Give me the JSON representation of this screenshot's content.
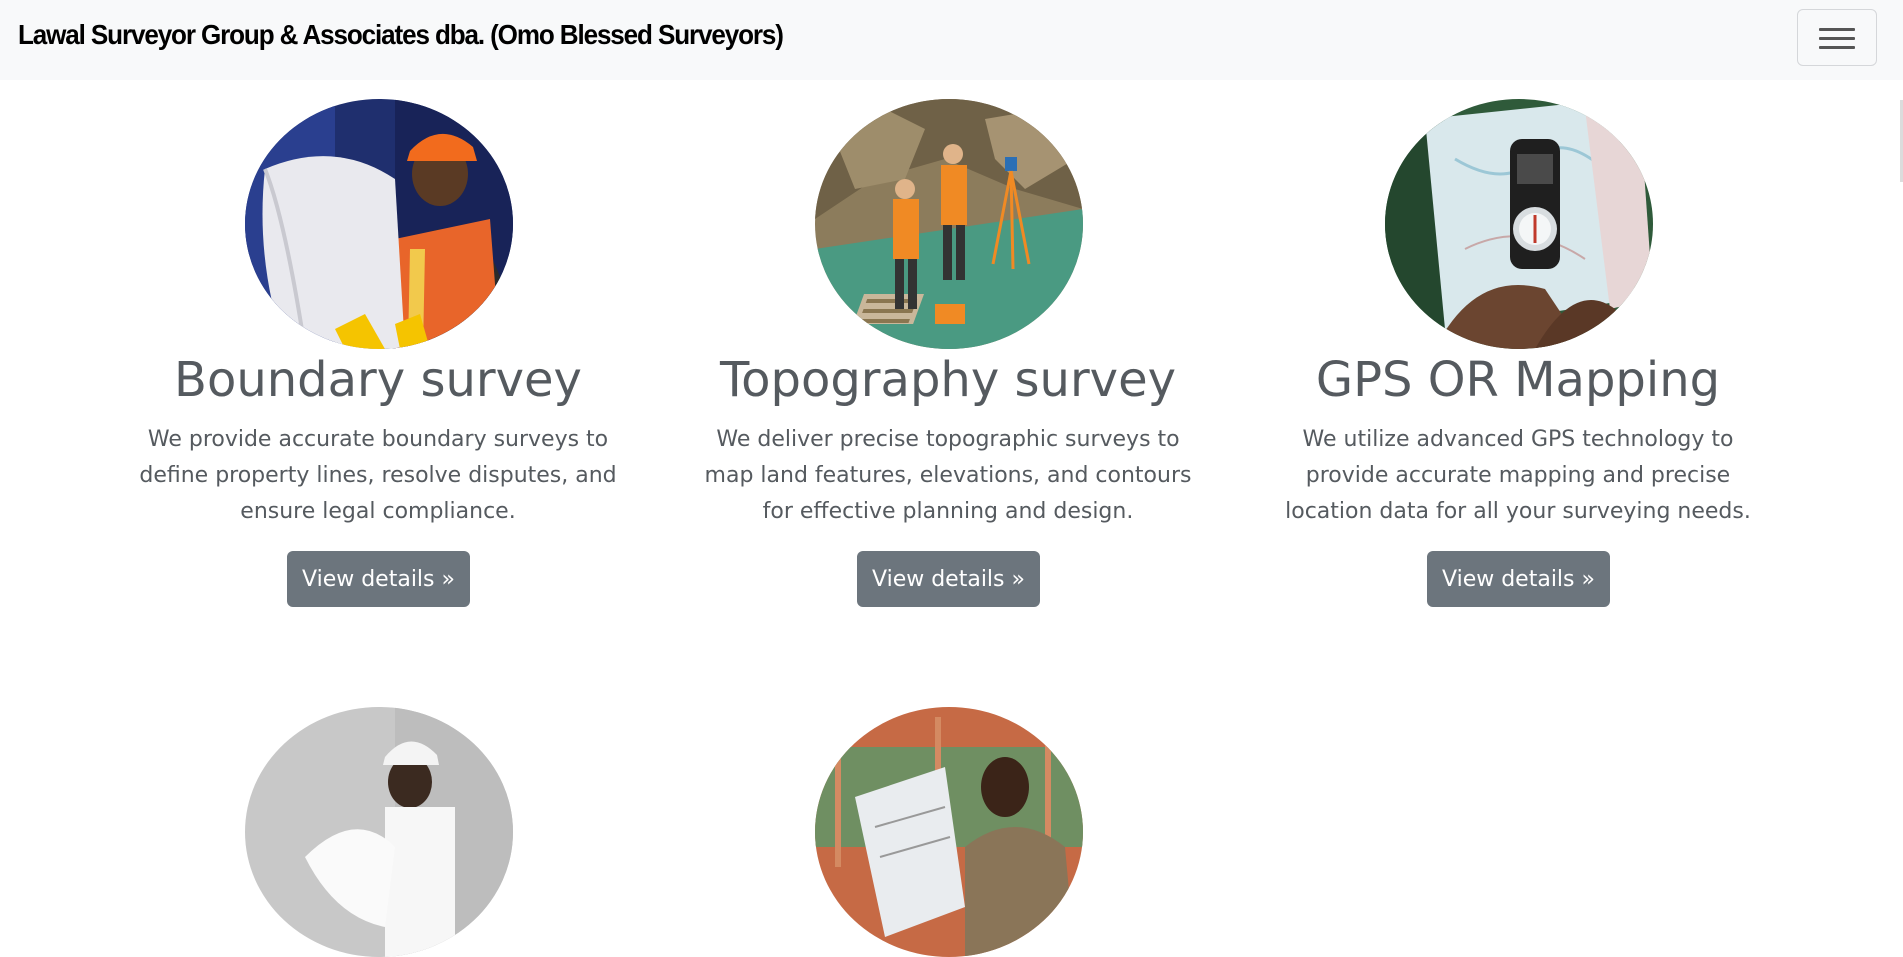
{
  "navbar": {
    "brand": "Lawal Surveyor Group & Associates dba. (Omo Blessed Surveyors)",
    "toggler_icon": "hamburger-menu-icon"
  },
  "cards": [
    {
      "title": "Boundary survey",
      "text": "We provide accurate boundary surveys to define property lines, resolve disputes, and ensure legal compliance.",
      "button": "View details »"
    },
    {
      "title": "Topography survey",
      "text": "We deliver precise topographic surveys to map land features, elevations, and contours for effective planning and design.",
      "button": "View details »"
    },
    {
      "title": "GPS OR Mapping",
      "text": "We utilize advanced GPS technology to provide accurate mapping and precise location data for all your surveying needs.",
      "button": "View details »"
    }
  ],
  "colors": {
    "navbar_bg": "#f8f9fa",
    "button_bg": "#6c757d",
    "text": "#555a5f"
  }
}
